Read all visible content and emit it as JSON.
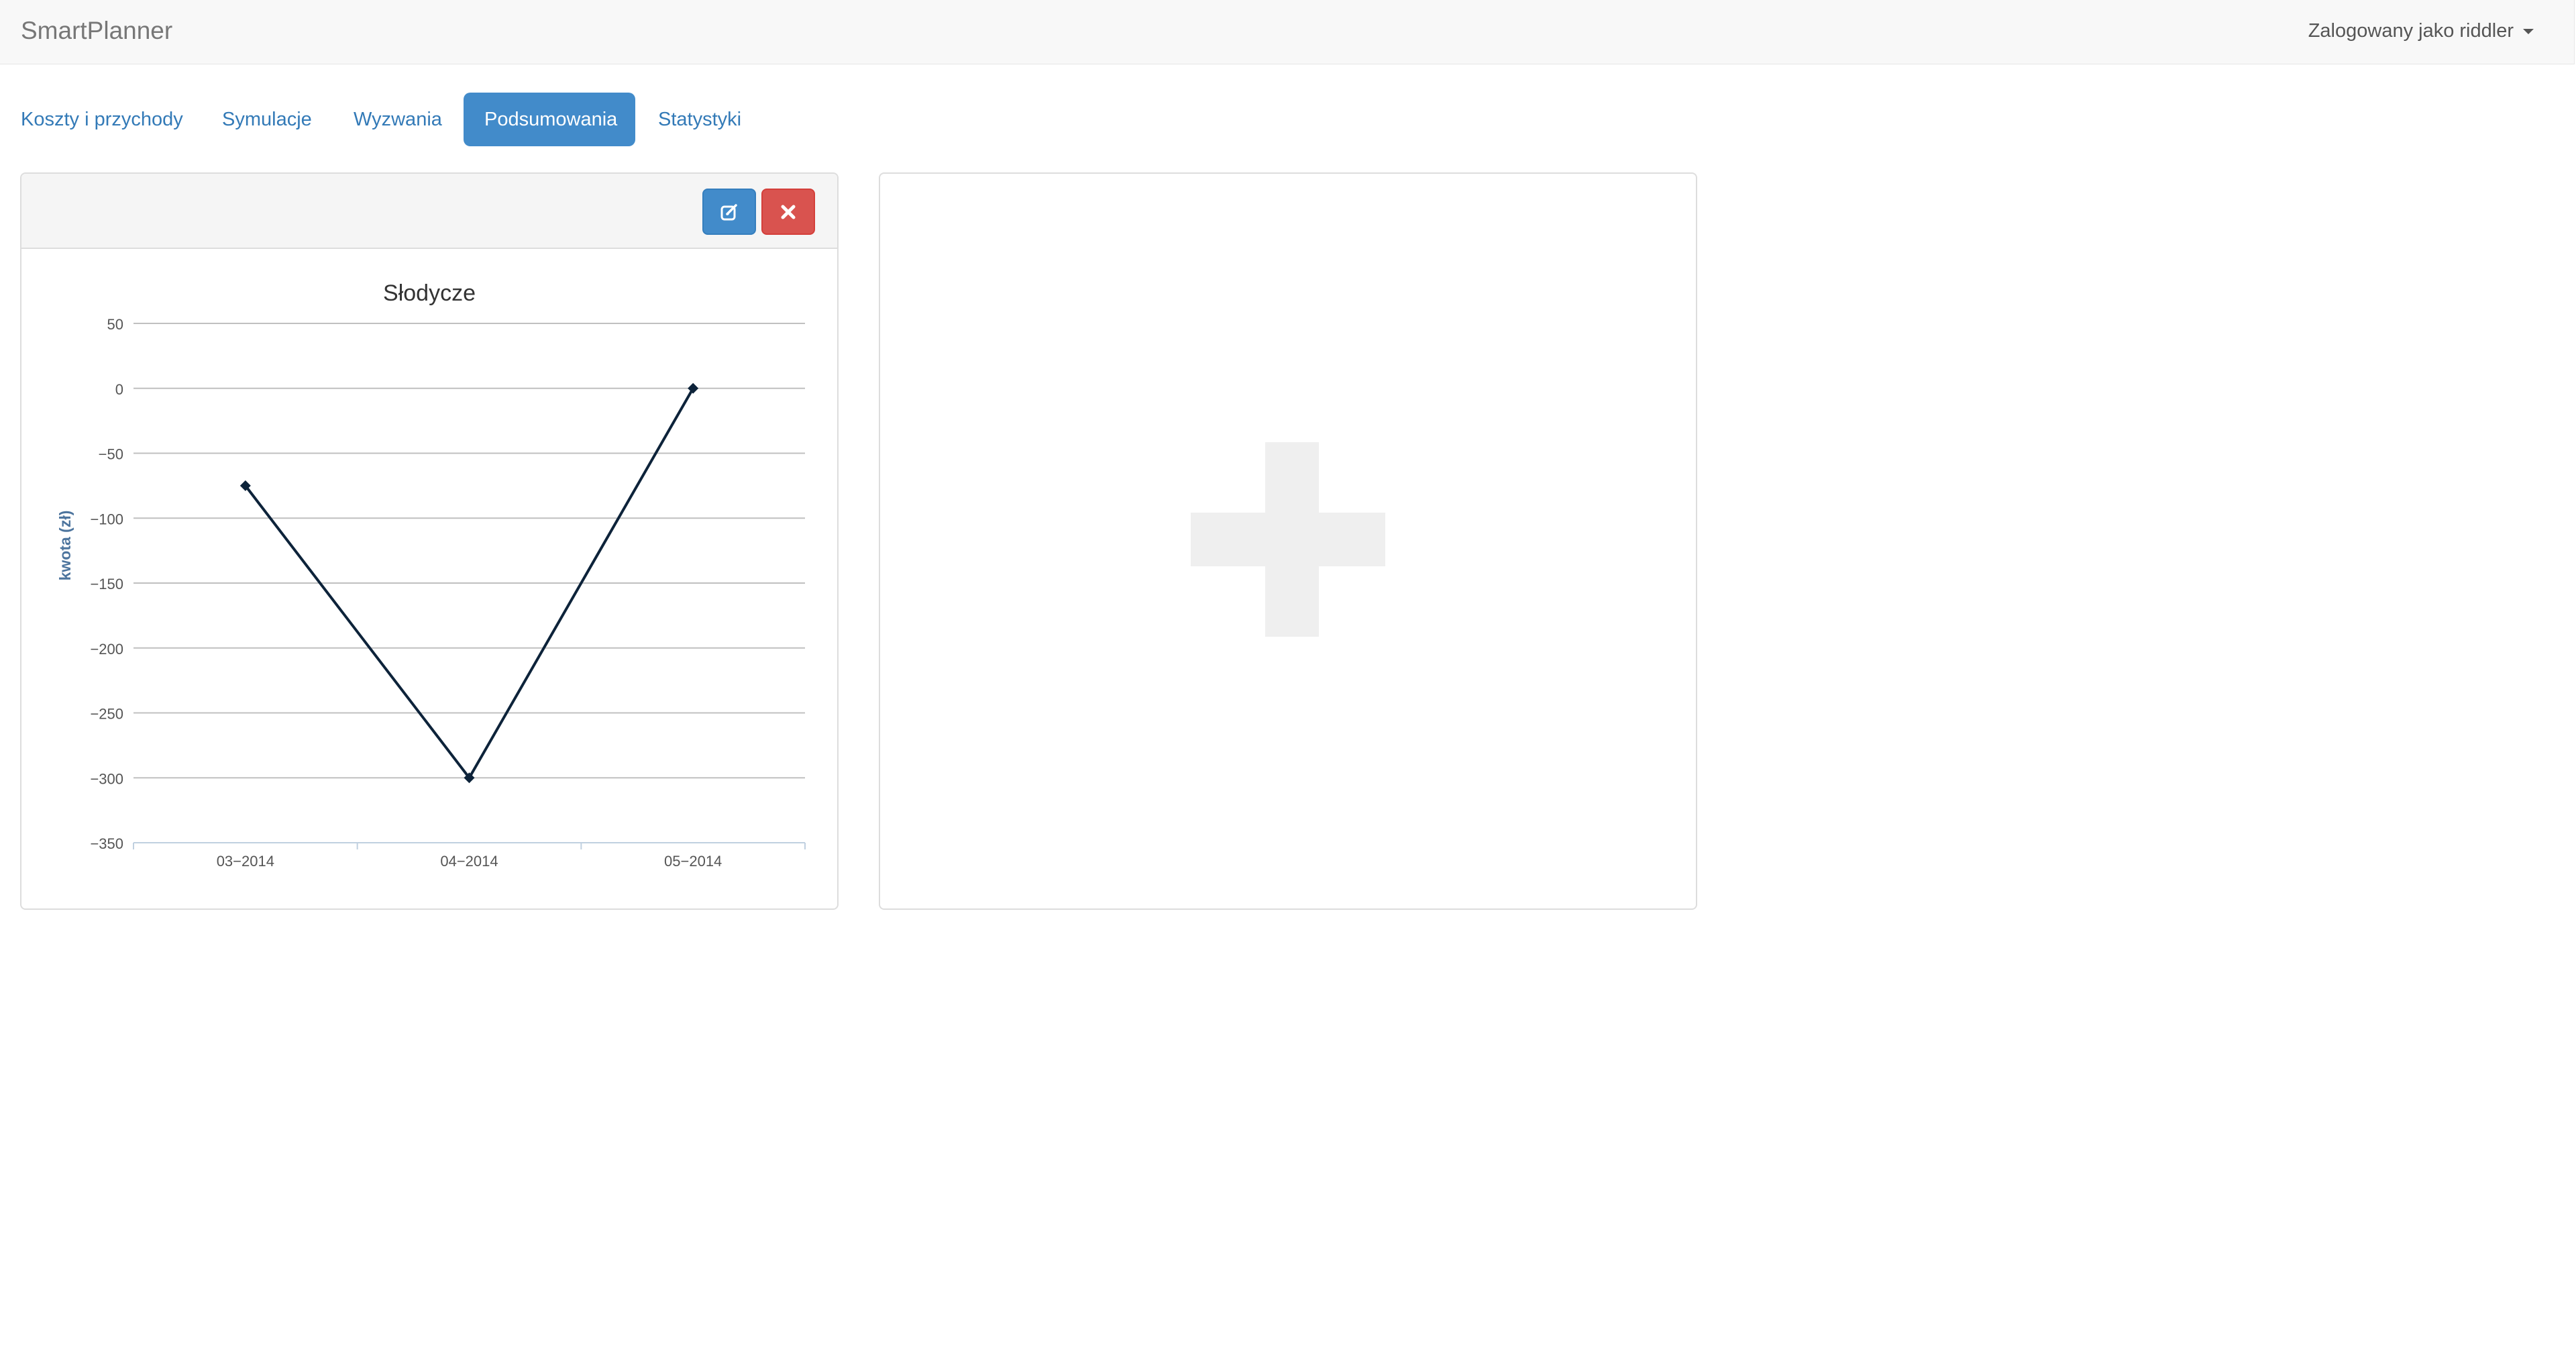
{
  "navbar": {
    "brand": "SmartPlanner",
    "user_label": "Zalogowany jako riddler"
  },
  "tabs": [
    {
      "label": "Koszty i przychody",
      "active": false
    },
    {
      "label": "Symulacje",
      "active": false
    },
    {
      "label": "Wyzwania",
      "active": false
    },
    {
      "label": "Podsumowania",
      "active": true
    },
    {
      "label": "Statystyki",
      "active": false
    }
  ],
  "summary_panel": {
    "edit_icon": "edit-icon",
    "delete_icon": "close-icon"
  },
  "add_panel": {
    "icon": "plus-icon"
  },
  "colors": {
    "accent": "#428bca",
    "danger": "#d9534f",
    "series": "#0d233a"
  },
  "chart_data": {
    "type": "line",
    "title": "Słodycze",
    "xlabel": "",
    "ylabel": "kwota (zł)",
    "categories": [
      "03-2014",
      "04-2014",
      "05-2014"
    ],
    "series": [
      {
        "values": [
          -75,
          -300,
          0
        ]
      }
    ],
    "ylim": [
      -350,
      50
    ],
    "yticks": [
      "50",
      "0",
      "-50",
      "-100",
      "-150",
      "-200",
      "-250",
      "-300",
      "-350"
    ],
    "grid": true
  }
}
